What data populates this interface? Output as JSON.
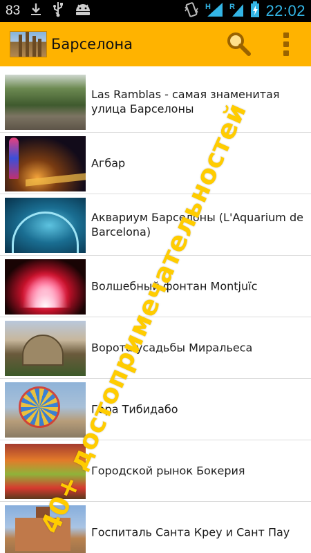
{
  "status_bar": {
    "notification_count": "83",
    "clock": "22:02",
    "network_h": "H",
    "network_r": "R",
    "icons": [
      "download-icon",
      "usb-icon",
      "android-icon",
      "vibrate-icon",
      "signal-icon",
      "battery-charging-icon"
    ]
  },
  "action_bar": {
    "title": "Барселона",
    "search_icon": "search-icon",
    "menu_icon": "overflow-menu-icon",
    "color": "#ffb300"
  },
  "list": {
    "items": [
      {
        "title": "Las Ramblas - самая знаменитая улица Барселоны"
      },
      {
        "title": "Агбар"
      },
      {
        "title": "Аквариум Барселоны (L'Aquarium de Barcelona)"
      },
      {
        "title": "Волшебный фонтан Montjuïc"
      },
      {
        "title": "Ворота усадьбы Миральеса"
      },
      {
        "title": "Гора Тибидабо"
      },
      {
        "title": "Городской рынок Бокерия"
      },
      {
        "title": "Госпиталь Санта Креу и Сант Пау"
      }
    ]
  },
  "watermark": {
    "text": "40+ достопримечательностей",
    "color": "#ffcc00"
  }
}
